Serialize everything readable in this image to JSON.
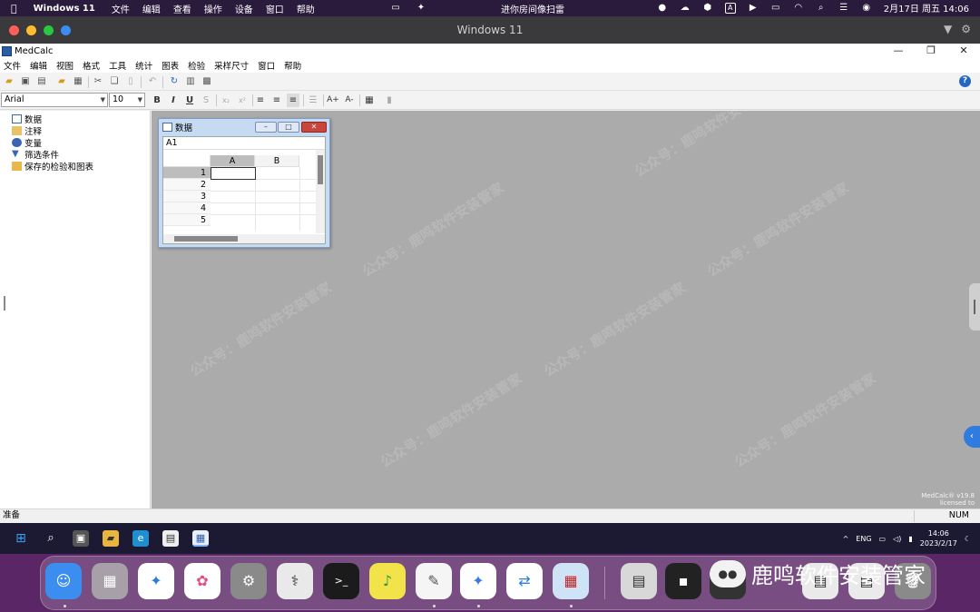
{
  "mac_menubar": {
    "app_name": "Windows 11",
    "items": [
      "文件",
      "编辑",
      "查看",
      "操作",
      "设备",
      "窗口",
      "帮助"
    ],
    "center_text": "进你房间像扫雷",
    "date_time": "2月17日 周五  14:06",
    "input_badge": "A"
  },
  "vm_window": {
    "title": "Windows 11"
  },
  "app": {
    "title": "MedCalc",
    "menu": [
      "文件",
      "编辑",
      "视图",
      "格式",
      "工具",
      "统计",
      "图表",
      "检验",
      "采样尺寸",
      "窗口",
      "帮助"
    ],
    "font_name": "Arial",
    "font_size": "10",
    "format_buttons": {
      "bold": "B",
      "italic": "I",
      "underline": "U",
      "strike": "S",
      "subscript": "x₂",
      "superscript": "x²",
      "grow": "A+",
      "shrink": "A-"
    },
    "help_label": "?"
  },
  "tree": {
    "items": [
      "数据",
      "注释",
      "变量",
      "筛选条件",
      "保存的检验和图表"
    ]
  },
  "data_window": {
    "title": "数据",
    "cell_ref": "A1",
    "columns": [
      "A",
      "B"
    ],
    "rows": [
      "1",
      "2",
      "3",
      "4",
      "5"
    ]
  },
  "license": {
    "line1": "MedCalc® v19.8",
    "line2": "licensed to"
  },
  "watermark": "公众号：鹿鸣软件安装管家",
  "status": {
    "ready": "准备",
    "num": "NUM"
  },
  "taskbar": {
    "lang": "ENG",
    "time": "14:06",
    "date": "2023/2/17"
  },
  "dock": {
    "brand_text": "鹿鸣软件安装管家"
  },
  "colors": {
    "mac_bar": "#2a1a3c",
    "mdi_bg": "#ababab",
    "accent": "#2566c5"
  }
}
